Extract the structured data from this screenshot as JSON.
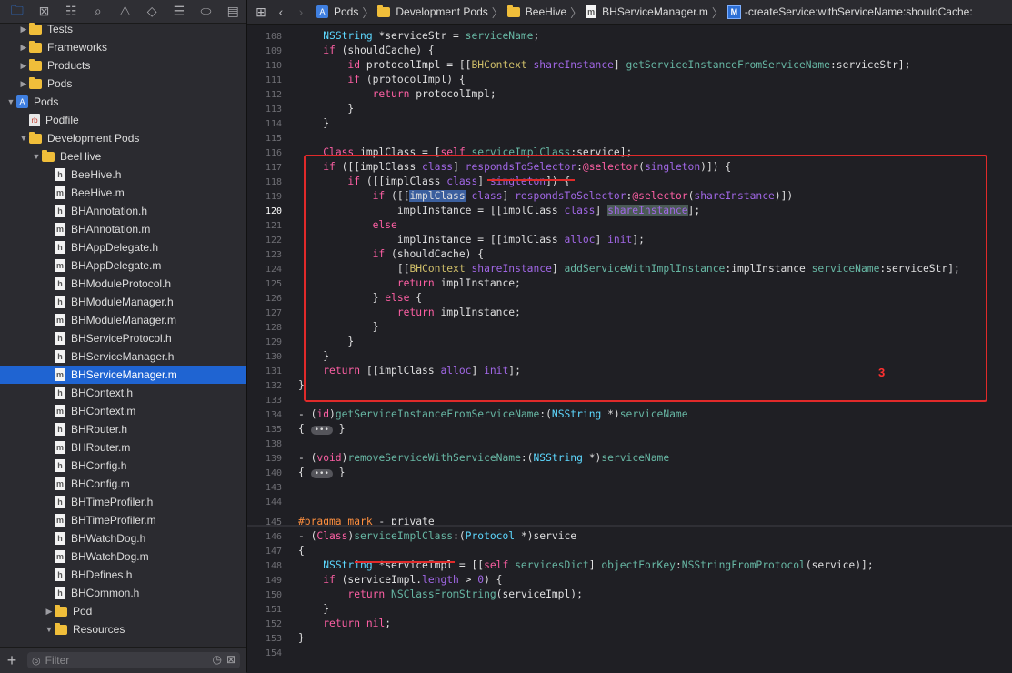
{
  "navigator": {
    "toolbar_icons": [
      "folder-icon",
      "x-square-icon",
      "hierarchy-icon",
      "magnifier-icon",
      "warning-icon",
      "diamond-icon",
      "list-icon",
      "label-icon",
      "bubble-icon"
    ],
    "tree": [
      {
        "label": "Tests",
        "kind": "folder",
        "indent": 1,
        "disclosure": "closed"
      },
      {
        "label": "Frameworks",
        "kind": "folder",
        "indent": 1,
        "disclosure": "closed"
      },
      {
        "label": "Products",
        "kind": "folder",
        "indent": 1,
        "disclosure": "closed"
      },
      {
        "label": "Pods",
        "kind": "folder",
        "indent": 1,
        "disclosure": "closed"
      },
      {
        "label": "Pods",
        "kind": "project",
        "indent": 0,
        "disclosure": "open"
      },
      {
        "label": "Podfile",
        "kind": "podfile",
        "indent": 1,
        "disclosure": ""
      },
      {
        "label": "Development Pods",
        "kind": "folder",
        "indent": 1,
        "disclosure": "open"
      },
      {
        "label": "BeeHive",
        "kind": "folder",
        "indent": 2,
        "disclosure": "open"
      },
      {
        "label": "BeeHive.h",
        "kind": "h",
        "indent": 3,
        "disclosure": ""
      },
      {
        "label": "BeeHive.m",
        "kind": "m",
        "indent": 3,
        "disclosure": ""
      },
      {
        "label": "BHAnnotation.h",
        "kind": "h",
        "indent": 3,
        "disclosure": ""
      },
      {
        "label": "BHAnnotation.m",
        "kind": "m",
        "indent": 3,
        "disclosure": ""
      },
      {
        "label": "BHAppDelegate.h",
        "kind": "h",
        "indent": 3,
        "disclosure": ""
      },
      {
        "label": "BHAppDelegate.m",
        "kind": "m",
        "indent": 3,
        "disclosure": ""
      },
      {
        "label": "BHModuleProtocol.h",
        "kind": "h",
        "indent": 3,
        "disclosure": ""
      },
      {
        "label": "BHModuleManager.h",
        "kind": "h",
        "indent": 3,
        "disclosure": ""
      },
      {
        "label": "BHModuleManager.m",
        "kind": "m",
        "indent": 3,
        "disclosure": ""
      },
      {
        "label": "BHServiceProtocol.h",
        "kind": "h",
        "indent": 3,
        "disclosure": ""
      },
      {
        "label": "BHServiceManager.h",
        "kind": "h",
        "indent": 3,
        "disclosure": ""
      },
      {
        "label": "BHServiceManager.m",
        "kind": "m",
        "indent": 3,
        "disclosure": "",
        "selected": true
      },
      {
        "label": "BHContext.h",
        "kind": "h",
        "indent": 3,
        "disclosure": ""
      },
      {
        "label": "BHContext.m",
        "kind": "m",
        "indent": 3,
        "disclosure": ""
      },
      {
        "label": "BHRouter.h",
        "kind": "h",
        "indent": 3,
        "disclosure": ""
      },
      {
        "label": "BHRouter.m",
        "kind": "m",
        "indent": 3,
        "disclosure": ""
      },
      {
        "label": "BHConfig.h",
        "kind": "h",
        "indent": 3,
        "disclosure": ""
      },
      {
        "label": "BHConfig.m",
        "kind": "m",
        "indent": 3,
        "disclosure": ""
      },
      {
        "label": "BHTimeProfiler.h",
        "kind": "h",
        "indent": 3,
        "disclosure": ""
      },
      {
        "label": "BHTimeProfiler.m",
        "kind": "m",
        "indent": 3,
        "disclosure": ""
      },
      {
        "label": "BHWatchDog.h",
        "kind": "h",
        "indent": 3,
        "disclosure": ""
      },
      {
        "label": "BHWatchDog.m",
        "kind": "m",
        "indent": 3,
        "disclosure": ""
      },
      {
        "label": "BHDefines.h",
        "kind": "h",
        "indent": 3,
        "disclosure": ""
      },
      {
        "label": "BHCommon.h",
        "kind": "h",
        "indent": 3,
        "disclosure": ""
      },
      {
        "label": "Pod",
        "kind": "folder",
        "indent": 3,
        "disclosure": "closed"
      },
      {
        "label": "Resources",
        "kind": "folder",
        "indent": 3,
        "disclosure": "open"
      }
    ],
    "filter_placeholder": "Filter"
  },
  "jumpbar": {
    "crumbs": [
      "Pods",
      "Development Pods",
      "BeeHive",
      "BHServiceManager.m",
      "-createService:withServiceName:shouldCache:"
    ],
    "method_badge": "M"
  },
  "editor": {
    "current_line": 120,
    "annotation_number": "3",
    "lines": [
      {
        "n": "108",
        "t": "    NSString *serviceStr = serviceName;"
      },
      {
        "n": "109",
        "t": "    if (shouldCache) {"
      },
      {
        "n": "110",
        "t": "        id protocolImpl = [[BHContext shareInstance] getServiceInstanceFromServiceName:serviceStr];"
      },
      {
        "n": "111",
        "t": "        if (protocolImpl) {"
      },
      {
        "n": "112",
        "t": "            return protocolImpl;"
      },
      {
        "n": "113",
        "t": "        }"
      },
      {
        "n": "114",
        "t": "    }"
      },
      {
        "n": "115",
        "t": ""
      },
      {
        "n": "116",
        "t": "    Class implClass = [self serviceImplClass:service];"
      },
      {
        "n": "117",
        "t": "    if ([[implClass class] respondsToSelector:@selector(singleton)]) {"
      },
      {
        "n": "118",
        "t": "        if ([[implClass class] singleton]) {"
      },
      {
        "n": "119",
        "t": "            if ([[implClass class] respondsToSelector:@selector(shareInstance)])"
      },
      {
        "n": "120",
        "t": "                implInstance = [[implClass class] shareInstance];"
      },
      {
        "n": "121",
        "t": "            else"
      },
      {
        "n": "122",
        "t": "                implInstance = [[implClass alloc] init];"
      },
      {
        "n": "123",
        "t": "            if (shouldCache) {"
      },
      {
        "n": "124",
        "t": "                [[BHContext shareInstance] addServiceWithImplInstance:implInstance serviceName:serviceStr];"
      },
      {
        "n": "125",
        "t": "                return implInstance;"
      },
      {
        "n": "126",
        "t": "            } else {"
      },
      {
        "n": "127",
        "t": "                return implInstance;"
      },
      {
        "n": "128",
        "t": "            }"
      },
      {
        "n": "129",
        "t": "        }"
      },
      {
        "n": "130",
        "t": "    }"
      },
      {
        "n": "131",
        "t": "    return [[implClass alloc] init];"
      },
      {
        "n": "132",
        "t": "}"
      },
      {
        "n": "133",
        "t": ""
      },
      {
        "n": "134",
        "t": "- (id)getServiceInstanceFromServiceName:(NSString *)serviceName"
      },
      {
        "n": "135",
        "t": "{ ... }"
      },
      {
        "n": "138",
        "t": ""
      },
      {
        "n": "139",
        "t": "- (void)removeServiceWithServiceName:(NSString *)serviceName"
      },
      {
        "n": "140",
        "t": "{ ... }"
      },
      {
        "n": "143",
        "t": ""
      },
      {
        "n": "144",
        "t": ""
      },
      {
        "n": "145",
        "t": "#pragma mark - private"
      },
      {
        "n": "146",
        "t": "- (Class)serviceImplClass:(Protocol *)service"
      },
      {
        "n": "147",
        "t": "{"
      },
      {
        "n": "148",
        "t": "    NSString *serviceImpl = [[self servicesDict] objectForKey:NSStringFromProtocol(service)];"
      },
      {
        "n": "149",
        "t": "    if (serviceImpl.length > 0) {"
      },
      {
        "n": "150",
        "t": "        return NSClassFromString(serviceImpl);"
      },
      {
        "n": "151",
        "t": "    }"
      },
      {
        "n": "152",
        "t": "    return nil;"
      },
      {
        "n": "153",
        "t": "}"
      },
      {
        "n": "154",
        "t": ""
      }
    ]
  },
  "colors": {
    "accent": "#1f64d2",
    "annotation": "#e02a2a",
    "keyword": "#fc5fa3"
  }
}
